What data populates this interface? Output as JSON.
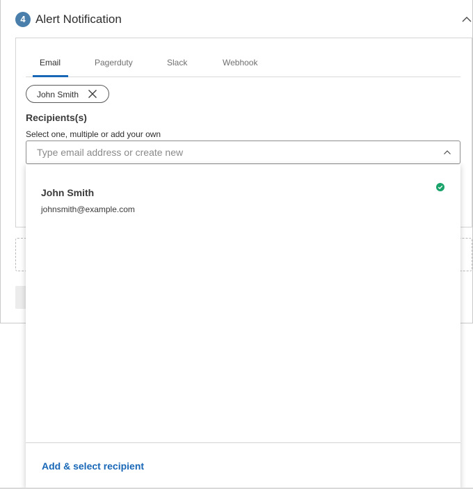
{
  "section": {
    "step_number": "4",
    "title": "Alert Notification"
  },
  "tabs": [
    {
      "label": "Email",
      "active": true
    },
    {
      "label": "Pagerduty",
      "active": false
    },
    {
      "label": "Slack",
      "active": false
    },
    {
      "label": "Webhook",
      "active": false
    }
  ],
  "selected_chip": {
    "label": "John Smith"
  },
  "recipients": {
    "label": "Recipients(s)",
    "help_text": "Select one, multiple or add your own",
    "input_value": "",
    "placeholder": "Type email address or create new"
  },
  "dropdown": {
    "options": [
      {
        "name": "John Smith",
        "email": "johnsmith@example.com",
        "selected": true
      }
    ],
    "add_label": "Add & select recipient"
  },
  "colors": {
    "accent": "#1867b7",
    "step_badge": "#4a7fab",
    "selected_check": "#1aa36b"
  },
  "icons": {
    "collapse": "chevron-up-icon",
    "chip_remove": "close-icon",
    "input_toggle": "chevron-up-icon",
    "selected": "check-circle-icon"
  }
}
